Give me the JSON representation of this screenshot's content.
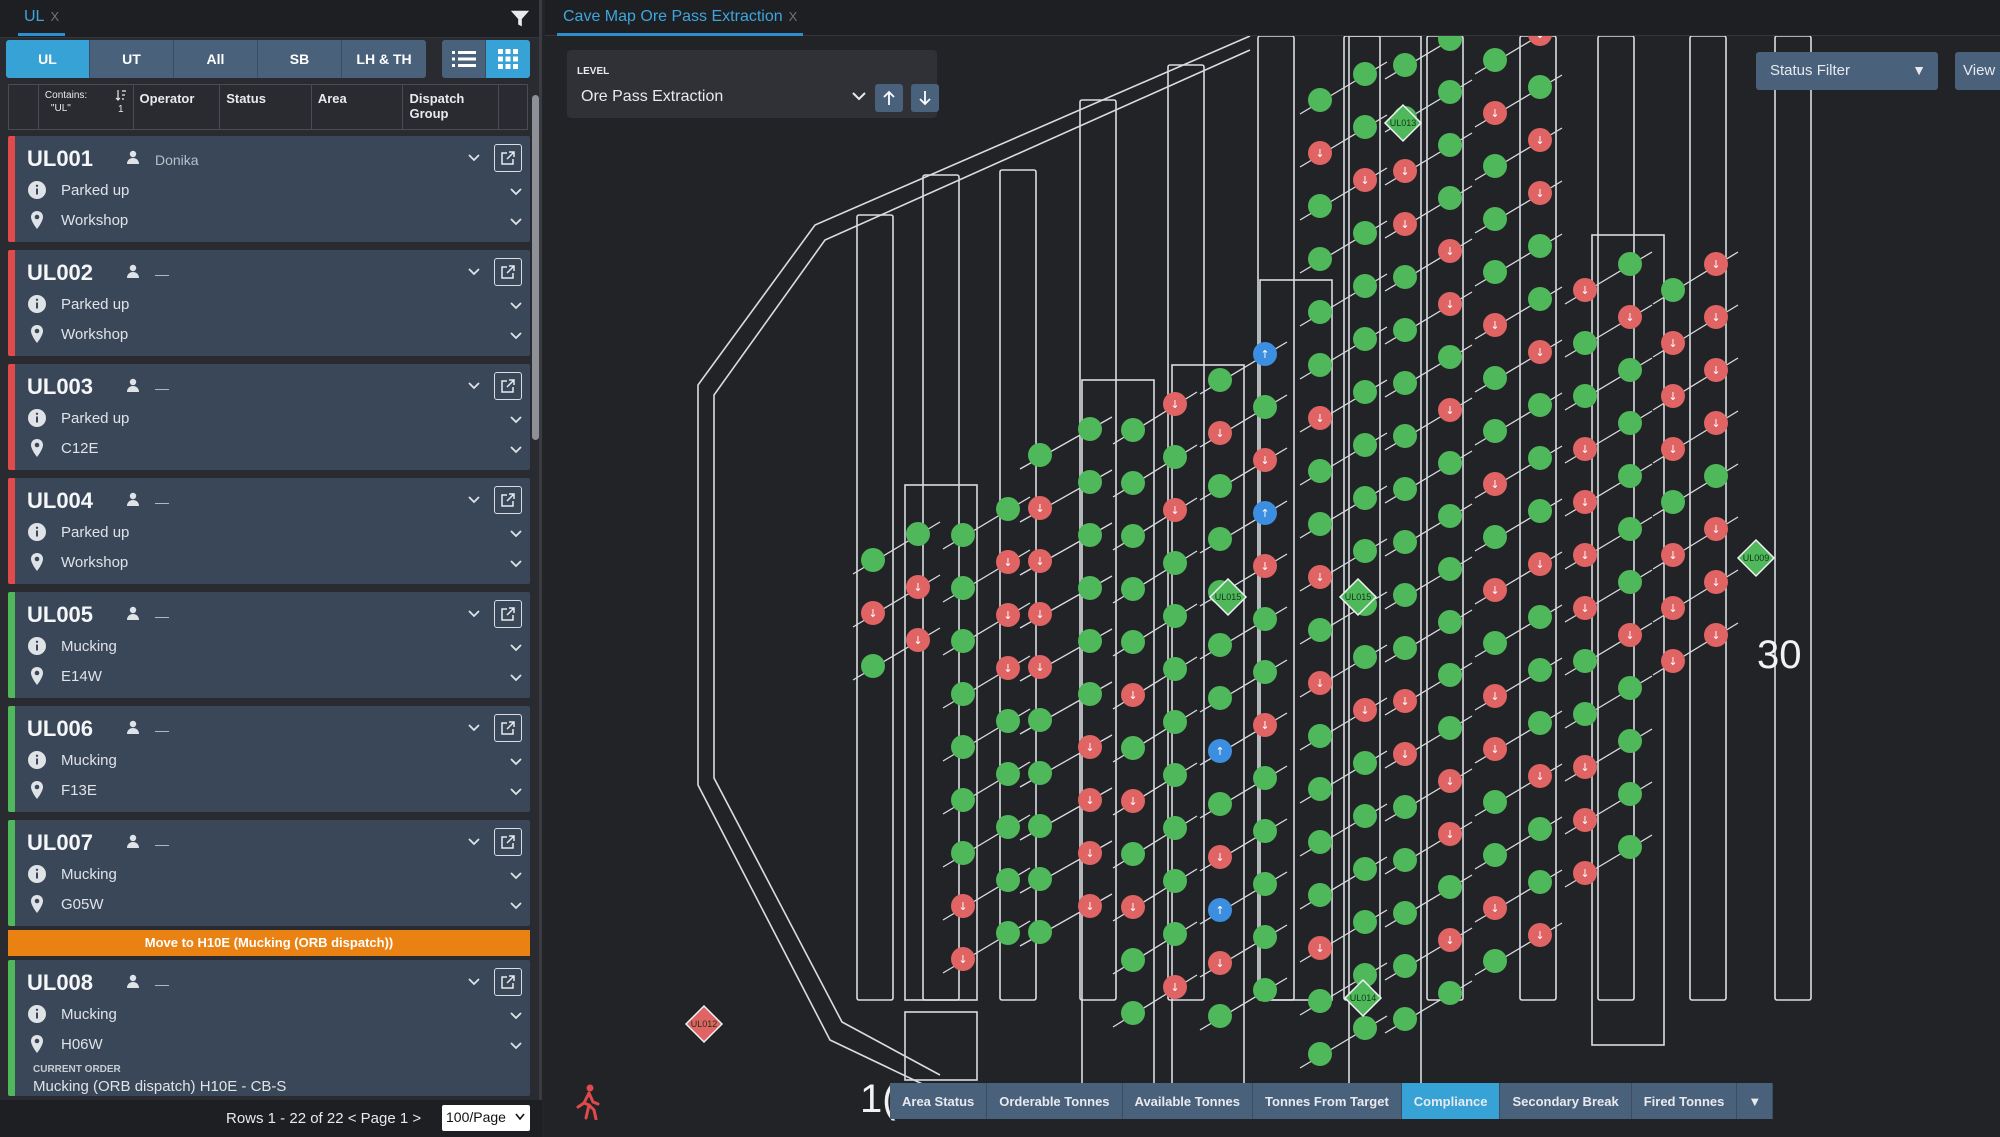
{
  "left": {
    "tab": {
      "label": "UL",
      "close": "X"
    },
    "segments": [
      {
        "label": "UL",
        "active": true
      },
      {
        "label": "UT",
        "active": false
      },
      {
        "label": "All",
        "active": false
      },
      {
        "label": "SB",
        "active": false
      },
      {
        "label": "LH & TH",
        "active": false
      }
    ],
    "view_icons": [
      "list-icon",
      "grid-icon"
    ],
    "table_header": {
      "id_filter_line1": "Contains:",
      "id_filter_line2": "\"UL\"",
      "sort_rank": "1",
      "operator": "Operator",
      "status": "Status",
      "area": "Area",
      "dispatch_line1": "Dispatch",
      "dispatch_line2": "Group"
    },
    "cards": [
      {
        "id": "UL001",
        "operator": "Donika",
        "status": "Parked up",
        "area": "Workshop",
        "state_color": "#e04a4a"
      },
      {
        "id": "UL002",
        "operator": "—",
        "status": "Parked up",
        "area": "Workshop",
        "state_color": "#e04a4a"
      },
      {
        "id": "UL003",
        "operator": "—",
        "status": "Parked up",
        "area": "C12E",
        "state_color": "#e04a4a"
      },
      {
        "id": "UL004",
        "operator": "—",
        "status": "Parked up",
        "area": "Workshop",
        "state_color": "#e04a4a"
      },
      {
        "id": "UL005",
        "operator": "—",
        "status": "Mucking",
        "area": "E14W",
        "state_color": "#4fb85a"
      },
      {
        "id": "UL006",
        "operator": "—",
        "status": "Mucking",
        "area": "F13E",
        "state_color": "#4fb85a"
      },
      {
        "id": "UL007",
        "operator": "—",
        "status": "Mucking",
        "area": "G05W",
        "state_color": "#4fb85a"
      },
      {
        "id": "UL008",
        "operator": "—",
        "status": "Mucking",
        "area": "H06W",
        "state_color": "#4fb85a",
        "banner": "Move to H10E (Mucking (ORB dispatch))",
        "current_order_label": "CURRENT ORDER",
        "current_order_value": "Mucking (ORB dispatch) H10E - CB-S"
      }
    ],
    "footer": {
      "rows_info": "Rows 1 - 22 of 22  <  Page 1  >",
      "page_size": "100/Page"
    }
  },
  "map": {
    "tab": {
      "label": "Cave Map Ore Pass Extraction",
      "close": "X"
    },
    "level": {
      "label": "LEVEL",
      "value": "Ore Pass Extraction"
    },
    "status_filter": "Status Filter",
    "view_button": "View",
    "labels": {
      "row_30": "30",
      "row_10_partial": "1("
    },
    "vehicle_markers": [
      "UL013",
      "UL015",
      "UL015",
      "UL009",
      "UL014",
      "UL012"
    ],
    "bottom_tabs": [
      {
        "label": "Area Status",
        "active": false
      },
      {
        "label": "Orderable Tonnes",
        "active": false
      },
      {
        "label": "Available Tonnes",
        "active": false
      },
      {
        "label": "Tonnes From Target",
        "active": false
      },
      {
        "label": "Compliance",
        "active": true
      },
      {
        "label": "Secondary Break",
        "active": false
      },
      {
        "label": "Fired Tonnes",
        "active": false
      }
    ],
    "colors": {
      "green": "#4fb85a",
      "red": "#e06464",
      "blue": "#3b8ee0",
      "grey": "#7d8a80"
    }
  }
}
